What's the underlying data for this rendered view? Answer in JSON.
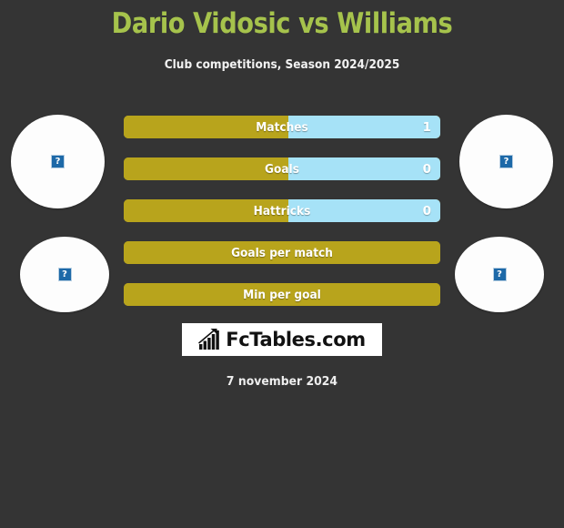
{
  "header": {
    "title": "Dario Vidosic vs Williams",
    "subtitle": "Club competitions, Season 2024/2025",
    "title_color": "#a6c34c"
  },
  "theme": {
    "background": "#343434",
    "bar_left_color": "#b8a41c",
    "bar_right_color": "#a6e2f7",
    "text_color": "#ffffff"
  },
  "players": {
    "left": {
      "photo_alt": "broken-image",
      "photo_icon": "broken-image-icon"
    },
    "right": {
      "photo_alt": "broken-image",
      "photo_icon": "broken-image-icon"
    }
  },
  "stats": [
    {
      "label": "Matches",
      "left_value": "",
      "right_value": "1",
      "left_pct": 52,
      "right_pct": 48,
      "split": true
    },
    {
      "label": "Goals",
      "left_value": "",
      "right_value": "0",
      "left_pct": 52,
      "right_pct": 48,
      "split": true
    },
    {
      "label": "Hattricks",
      "left_value": "",
      "right_value": "0",
      "left_pct": 52,
      "right_pct": 48,
      "split": true
    },
    {
      "label": "Goals per match",
      "left_value": "",
      "right_value": "",
      "left_pct": 100,
      "right_pct": 0,
      "split": false
    },
    {
      "label": "Min per goal",
      "left_value": "",
      "right_value": "",
      "left_pct": 100,
      "right_pct": 0,
      "split": false
    }
  ],
  "footer": {
    "logo_text": "FcTables.com",
    "logo_icon": "bar-chart-growth-icon",
    "date": "7 november 2024"
  }
}
